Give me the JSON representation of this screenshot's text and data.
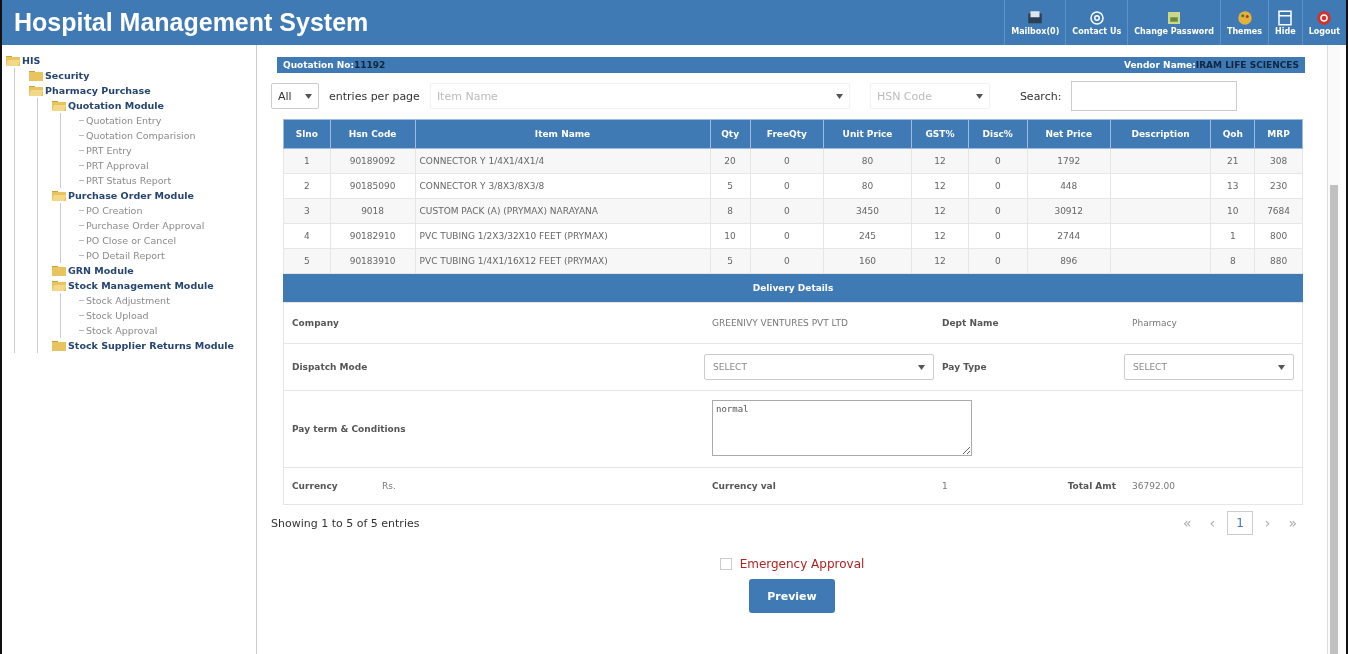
{
  "header": {
    "title": "Hospital Management System",
    "actions": [
      "Mailbox(0)",
      "Contact Us",
      "Change Password",
      "Themes",
      "Hide",
      "Logout"
    ]
  },
  "sidebar": {
    "tree": [
      {
        "label": "HIS",
        "kind": "folder",
        "expanded": true,
        "children": [
          {
            "label": "Security",
            "kind": "folder",
            "expanded": false
          },
          {
            "label": "Pharmacy Purchase",
            "kind": "folder",
            "expanded": true,
            "children": [
              {
                "label": "Quotation Module",
                "kind": "folder",
                "expanded": true,
                "children": [
                  {
                    "label": "Quotation Entry",
                    "kind": "page"
                  },
                  {
                    "label": "Quotation Comparision",
                    "kind": "page"
                  },
                  {
                    "label": "PRT Entry",
                    "kind": "page"
                  },
                  {
                    "label": "PRT Approval",
                    "kind": "page"
                  },
                  {
                    "label": "PRT Status Report",
                    "kind": "page"
                  }
                ]
              },
              {
                "label": "Purchase Order Module",
                "kind": "folder",
                "expanded": true,
                "children": [
                  {
                    "label": "PO Creation",
                    "kind": "page"
                  },
                  {
                    "label": "Purchase Order Approval",
                    "kind": "page"
                  },
                  {
                    "label": "PO Close or Cancel",
                    "kind": "page"
                  },
                  {
                    "label": "PO Detail Report",
                    "kind": "page"
                  }
                ]
              },
              {
                "label": "GRN Module",
                "kind": "folder",
                "expanded": false
              },
              {
                "label": "Stock Management Module",
                "kind": "folder",
                "expanded": true,
                "children": [
                  {
                    "label": "Stock Adjustment",
                    "kind": "page"
                  },
                  {
                    "label": "Stock Upload",
                    "kind": "page"
                  },
                  {
                    "label": "Stock Approval",
                    "kind": "page"
                  }
                ]
              },
              {
                "label": "Stock Supplier Returns Module",
                "kind": "folder",
                "expanded": false
              }
            ]
          }
        ]
      }
    ]
  },
  "quotation": {
    "number_label": "Quotation No:",
    "number": "11192",
    "vendor_label": "Vendor Name:",
    "vendor": "IRAM LIFE SCIENCES"
  },
  "filters": {
    "page_size": "All",
    "page_size_label": "entries per page",
    "item_name_placeholder": "Item Name",
    "hsn_placeholder": "HSN Code",
    "search_label": "Search:"
  },
  "table": {
    "columns": [
      "Slno",
      "Hsn Code",
      "Item Name",
      "Qty",
      "FreeQty",
      "Unit Price",
      "GST%",
      "Disc%",
      "Net Price",
      "Description",
      "Qoh",
      "MRP"
    ],
    "rows": [
      [
        "1",
        "90189092",
        "CONNECTOR Y 1/4X1/4X1/4",
        "20",
        "0",
        "80",
        "12",
        "0",
        "1792",
        "",
        "21",
        "308"
      ],
      [
        "2",
        "90185090",
        "CONNECTOR Y 3/8X3/8X3/8",
        "5",
        "0",
        "80",
        "12",
        "0",
        "448",
        "",
        "13",
        "230"
      ],
      [
        "3",
        "9018",
        "CUSTOM PACK (A) (PRYMAX) NARAYANA",
        "8",
        "0",
        "3450",
        "12",
        "0",
        "30912",
        "",
        "10",
        "7684"
      ],
      [
        "4",
        "90182910",
        "PVC TUBING 1/2X3/32X10 FEET (PRYMAX)",
        "10",
        "0",
        "245",
        "12",
        "0",
        "2744",
        "",
        "1",
        "800"
      ],
      [
        "5",
        "90183910",
        "PVC TUBING 1/4X1/16X12 FEET (PRYMAX)",
        "5",
        "0",
        "160",
        "12",
        "0",
        "896",
        "",
        "8",
        "880"
      ]
    ]
  },
  "delivery": {
    "title": "Delivery Details",
    "company_label": "Company",
    "company": "GREENIVY VENTURES PVT LTD",
    "dept_label": "Dept Name",
    "dept": "Pharmacy",
    "dispatch_label": "Dispatch Mode",
    "dispatch": "SELECT",
    "pay_type_label": "Pay Type",
    "pay_type": "SELECT",
    "terms_label": "Pay term & Conditions",
    "terms": "normal",
    "currency_label": "Currency",
    "currency": "Rs.",
    "currency_val_label": "Currency val",
    "currency_val": "1",
    "total_label": "Total Amt",
    "total": "36792.00"
  },
  "footer": {
    "info": "Showing 1 to 5 of 5 entries",
    "pages": [
      {
        "label": "«",
        "kind": "nav",
        "selected": false
      },
      {
        "label": "‹",
        "kind": "nav",
        "selected": false
      },
      {
        "label": "1",
        "kind": "page",
        "selected": true
      },
      {
        "label": "›",
        "kind": "nav",
        "selected": false
      },
      {
        "label": "»",
        "kind": "nav",
        "selected": false
      }
    ]
  },
  "emergency": {
    "label": "Emergency Approval",
    "checked": false
  },
  "preview_button": "Preview"
}
